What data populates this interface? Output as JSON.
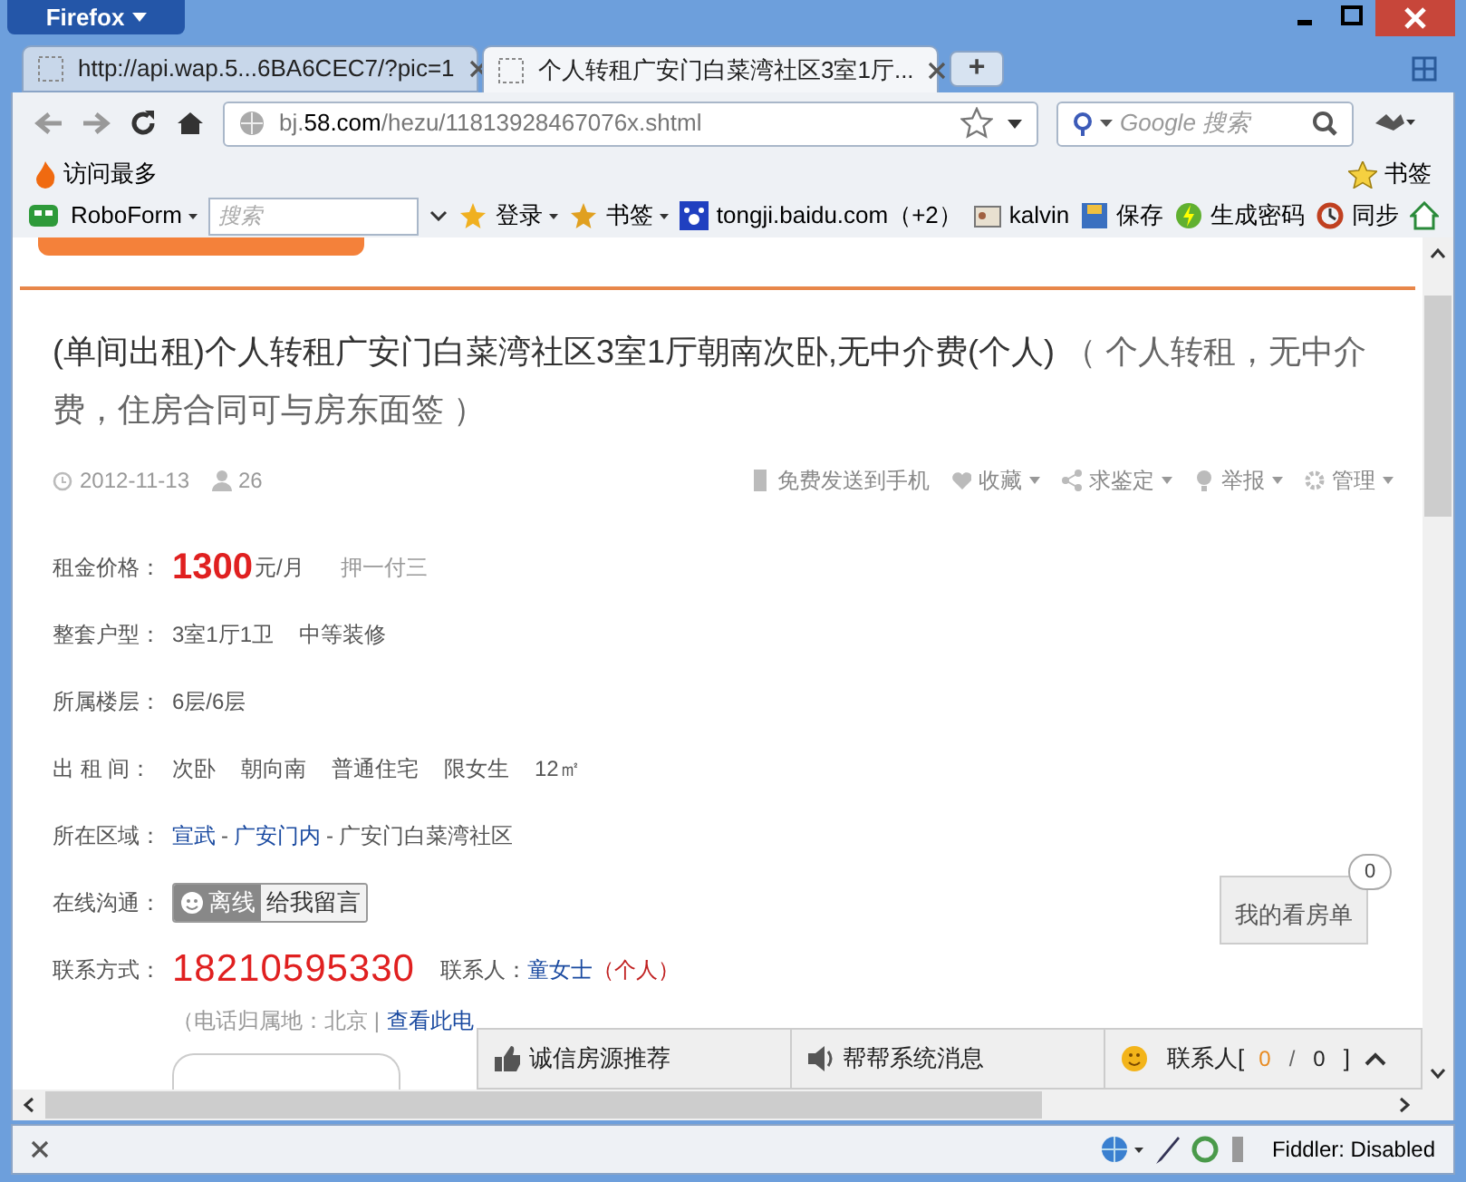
{
  "window": {
    "menu_button": "Firefox"
  },
  "tabs": [
    {
      "label": "http://api.wap.5...6BA6CEC7/?pic=1",
      "selected": false
    },
    {
      "label": "个人转租广安门白菜湾社区3室1厅...",
      "selected": true
    }
  ],
  "new_tab": "+",
  "address_bar": {
    "url": "bj.**58.com**/hezu/11813928467076x.shtml"
  },
  "search_bar": {
    "placeholder": "Google 搜索"
  },
  "bookmarks_bar": {
    "left": "访问最多",
    "right": "书签"
  },
  "toolbar": {
    "roboform": "RoboForm",
    "search_placeholder": "搜索",
    "items": [
      "登录",
      "书签",
      "tongji.baidu.com（+2）",
      "kalvin",
      "保存",
      "生成密码",
      "同步"
    ]
  },
  "listing": {
    "title": "(单间出租)个人转租广安门白菜湾社区3室1厅朝南次卧,无中介费(个人)",
    "subtitle": "（ 个人转租，无中介费，住房合同可与房东面签 ）",
    "date": "2012-11-13",
    "views": "26",
    "actions": [
      {
        "label": "免费发送到手机",
        "dropdown": false
      },
      {
        "label": "收藏",
        "dropdown": true
      },
      {
        "label": "求鉴定",
        "dropdown": true
      },
      {
        "label": "举报",
        "dropdown": true
      },
      {
        "label": "管理",
        "dropdown": true
      }
    ],
    "fields": [
      {
        "kind": "price",
        "label": "租金价格：",
        "price": "1300",
        "unit": "元/月",
        "note": "押一付三"
      },
      {
        "kind": "plain",
        "label": "整套户型：",
        "values": [
          "3室1厅1卫",
          "中等装修"
        ]
      },
      {
        "kind": "plain",
        "label": "所属楼层：",
        "values": [
          "6层/6层"
        ]
      },
      {
        "kind": "plain",
        "label": "出 租 间：",
        "values": [
          "次卧",
          "朝向南",
          "普通住宅",
          "限女生",
          "12㎡"
        ]
      },
      {
        "kind": "area",
        "label": "所在区域：",
        "links": [
          "宣武",
          "广安门内"
        ],
        "separators": [
          "-",
          "-"
        ],
        "text": "广安门白菜湾社区"
      },
      {
        "kind": "chat",
        "label": "在线沟通：",
        "status": "离线",
        "message": "给我留言"
      },
      {
        "kind": "contact",
        "label": "联系方式：",
        "phone": "18210595330",
        "person_label": "联系人：",
        "person": "童女士",
        "person_type": "（个人）"
      }
    ],
    "phone_note": "（电话归属地：北京 |",
    "phone_link": "查看此电"
  },
  "viewing_list": {
    "label": "我的看房单",
    "count": "0"
  },
  "bottom_bar": {
    "items": [
      "诚信房源推荐",
      "帮帮系统消息"
    ],
    "contacts_label": "联系人[",
    "online": "0",
    "sep": "/",
    "total": "0",
    "close": "]"
  },
  "status_bar": {
    "text": "Fiddler: Disabled"
  }
}
